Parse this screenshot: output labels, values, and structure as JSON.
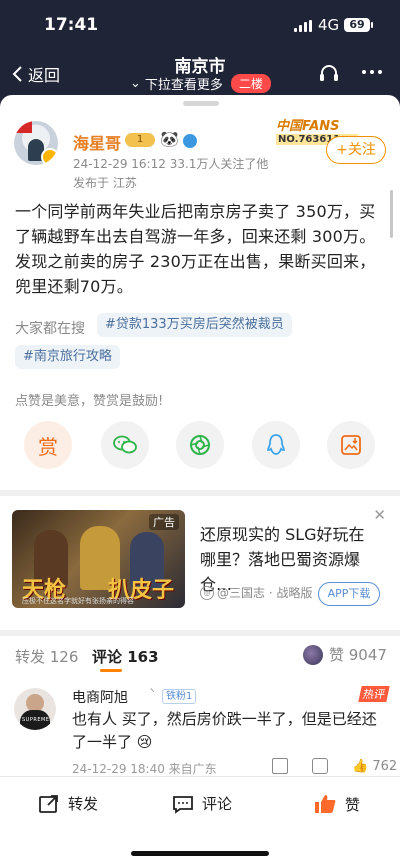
{
  "status": {
    "time": "17:41",
    "network": "4G",
    "battery": "69"
  },
  "nav": {
    "back_label": "返回",
    "title": "南京市",
    "subtitle": "下拉查看更多",
    "floor_badge": "二楼"
  },
  "post": {
    "author": "海星哥",
    "level": "1",
    "timestamp": "24-12-29 16:12",
    "followers_text": "33.1万人关注了他",
    "location_text": "发布于 江苏",
    "fan_badge_title": "中国FANS",
    "fan_badge_no": "NO.763611",
    "follow_label": "+关注",
    "body": "一个同学前两年失业后把南京房子卖了 350万，买了辆越野车出去自驾游一年多，回来还剩 300万。发现之前卖的房子 230万正在出售，果断买回来，兜里还剩70万。",
    "search_label": "大家都在搜",
    "chips": [
      "#贷款133万买房后突然被裁员",
      "#南京旅行攻略"
    ],
    "reward_hint": "点赞是美意，赞赏是鼓励!",
    "reward_label": "赏"
  },
  "ad": {
    "tag": "广告",
    "image_word1": "天枪",
    "image_word2": "扒皮子",
    "image_caption": "压极不住这名字就好有张扬亲的得容",
    "text": "还原现实的 SLG好玩在哪里？落地巴蜀资源爆仓…",
    "source": "@三国志 · 战略版",
    "download": "APP下载"
  },
  "tabs": {
    "repost": "转发 126",
    "comments": "评论 163",
    "likes": "赞 9047"
  },
  "comment": {
    "author": "电商阿旭",
    "chevron": "ᐠ",
    "fan_badge": "铁粉1",
    "hot": "热评",
    "avatar_text": "SUPREME",
    "text": "也有人 买了，然后房价跌一半了，但是已经还了一半了 😢",
    "footer": "24-12-29 18:40 来自广东",
    "like_count": "762"
  },
  "bottom": {
    "repost": "转发",
    "comment": "评论",
    "like": "赞"
  },
  "colors": {
    "accent": "#ff8200",
    "link": "#4a6f9c",
    "dark_bg": "#1f2437"
  }
}
